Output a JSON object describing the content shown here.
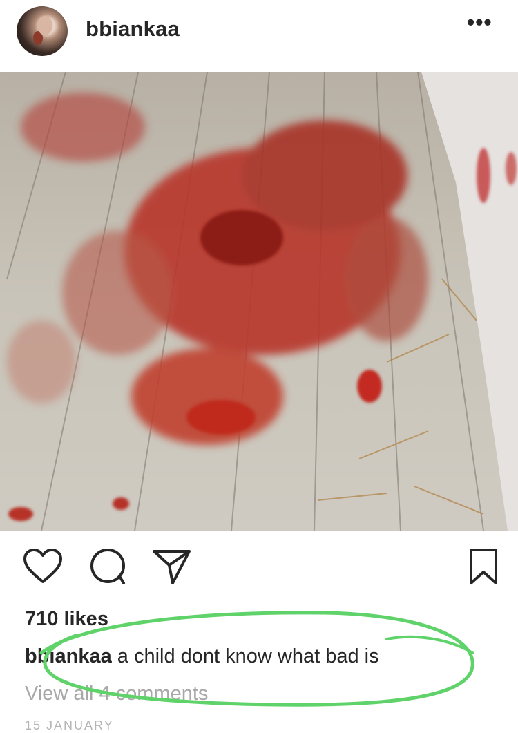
{
  "post": {
    "username": "bbiankaa",
    "more_label": "•••",
    "likes": "710 likes",
    "caption_user": "bbiankaa",
    "caption_text": "a child dont know what bad is",
    "view_comments": "View all 4 comments",
    "date": "15 JANUARY"
  },
  "icons": {
    "like": "heart-icon",
    "comment": "comment-icon",
    "share": "send-icon",
    "save": "bookmark-icon"
  },
  "colors": {
    "text": "#262626",
    "muted": "#a8a8a8",
    "highlight_marker": "#5fd36a"
  }
}
